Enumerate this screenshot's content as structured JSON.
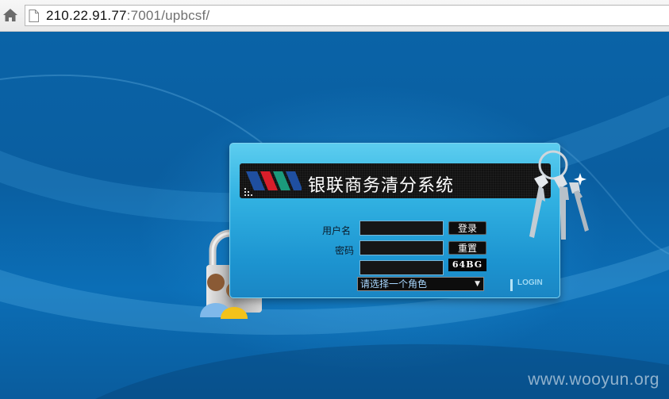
{
  "browser": {
    "url_host": "210.22.91.77",
    "url_rest": ":7001/upbcsf/"
  },
  "login": {
    "system_title": "银联商务清分系统",
    "username_label": "用户名",
    "password_label": "密码",
    "username_value": "",
    "password_value": "",
    "captcha_value": "",
    "login_button": "登录",
    "reset_button": "重置",
    "captcha_text": "64BG",
    "role_select_value": "请选择一个角色",
    "login_mark": "LOGIN"
  },
  "watermark": "www.wooyun.org",
  "colors": {
    "background": "#0a5fa2",
    "panel": "#32b2e2",
    "banner": "#121212"
  },
  "icons": [
    "home-icon",
    "page-icon",
    "logo-icon",
    "padlock-icon",
    "keys-icon"
  ]
}
